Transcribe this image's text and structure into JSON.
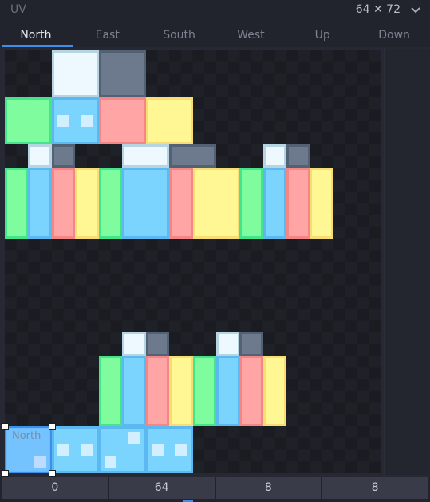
{
  "header": {
    "title": "UV",
    "texture_size": "64 ✕ 72",
    "dropdown_icon": "chevron-down-icon"
  },
  "tabs": [
    {
      "label": "North",
      "active": true
    },
    {
      "label": "East",
      "active": false
    },
    {
      "label": "South",
      "active": false
    },
    {
      "label": "West",
      "active": false
    },
    {
      "label": "Up",
      "active": false
    },
    {
      "label": "Down",
      "active": false
    }
  ],
  "texture": {
    "width_units": 64,
    "height_units": 72,
    "colors": {
      "top_border": "#b6d4e2",
      "top_fill": "#edf8ff",
      "bottom_border": "#526173",
      "bottom_fill": "#6d798c",
      "green_border": "#44e48a",
      "green_fill": "#7efc9e",
      "blue_border": "#5bb8f0",
      "blue_fill": "#7ad4fe",
      "red_border": "#f58686",
      "red_fill": "#ffa5a5",
      "yellow_border": "#f8dc74",
      "yellow_fill": "#fff793",
      "dot": "#d1efff"
    },
    "faces": [
      {
        "name": "head-up",
        "color": "top",
        "uv": [
          8,
          0,
          8,
          8
        ]
      },
      {
        "name": "head-down",
        "color": "bottom",
        "uv": [
          16,
          0,
          8,
          8
        ]
      },
      {
        "name": "head-east",
        "color": "green",
        "uv": [
          0,
          8,
          8,
          8
        ]
      },
      {
        "name": "head-north",
        "color": "blue",
        "uv": [
          8,
          8,
          8,
          8
        ],
        "dots": "eyes"
      },
      {
        "name": "head-west",
        "color": "red",
        "uv": [
          16,
          8,
          8,
          8
        ]
      },
      {
        "name": "head-south",
        "color": "yellow",
        "uv": [
          24,
          8,
          8,
          8
        ]
      },
      {
        "name": "leg-up",
        "color": "top",
        "uv": [
          4,
          16,
          4,
          4
        ]
      },
      {
        "name": "leg-down",
        "color": "bottom",
        "uv": [
          8,
          16,
          4,
          4
        ]
      },
      {
        "name": "leg-east",
        "color": "green",
        "uv": [
          0,
          20,
          4,
          12
        ]
      },
      {
        "name": "leg-north",
        "color": "blue",
        "uv": [
          4,
          20,
          4,
          12
        ]
      },
      {
        "name": "leg-west",
        "color": "red",
        "uv": [
          8,
          20,
          4,
          12
        ]
      },
      {
        "name": "leg-south",
        "color": "yellow",
        "uv": [
          12,
          20,
          4,
          12
        ]
      },
      {
        "name": "body-up",
        "color": "top",
        "uv": [
          20,
          16,
          8,
          4
        ]
      },
      {
        "name": "body-down",
        "color": "bottom",
        "uv": [
          28,
          16,
          8,
          4
        ]
      },
      {
        "name": "body-east",
        "color": "green",
        "uv": [
          16,
          20,
          4,
          12
        ]
      },
      {
        "name": "body-north",
        "color": "blue",
        "uv": [
          20,
          20,
          8,
          12
        ]
      },
      {
        "name": "body-west",
        "color": "red",
        "uv": [
          28,
          20,
          4,
          12
        ]
      },
      {
        "name": "body-south",
        "color": "yellow",
        "uv": [
          32,
          20,
          8,
          12
        ]
      },
      {
        "name": "arm-up",
        "color": "top",
        "uv": [
          44,
          16,
          4,
          4
        ]
      },
      {
        "name": "arm-down",
        "color": "bottom",
        "uv": [
          48,
          16,
          4,
          4
        ]
      },
      {
        "name": "arm-east",
        "color": "green",
        "uv": [
          40,
          20,
          4,
          12
        ]
      },
      {
        "name": "arm-north",
        "color": "blue",
        "uv": [
          44,
          20,
          4,
          12
        ]
      },
      {
        "name": "arm-west",
        "color": "red",
        "uv": [
          48,
          20,
          4,
          12
        ]
      },
      {
        "name": "arm-south",
        "color": "yellow",
        "uv": [
          52,
          20,
          4,
          12
        ]
      },
      {
        "name": "left-leg-up",
        "color": "top",
        "uv": [
          20,
          48,
          4,
          4
        ]
      },
      {
        "name": "left-leg-down",
        "color": "bottom",
        "uv": [
          24,
          48,
          4,
          4
        ]
      },
      {
        "name": "left-leg-east",
        "color": "green",
        "uv": [
          16,
          52,
          4,
          12
        ]
      },
      {
        "name": "left-leg-north",
        "color": "blue",
        "uv": [
          20,
          52,
          4,
          12
        ]
      },
      {
        "name": "left-leg-west",
        "color": "red",
        "uv": [
          24,
          52,
          4,
          12
        ]
      },
      {
        "name": "left-leg-south",
        "color": "yellow",
        "uv": [
          28,
          52,
          4,
          12
        ]
      },
      {
        "name": "left-arm-up",
        "color": "top",
        "uv": [
          36,
          48,
          4,
          4
        ]
      },
      {
        "name": "left-arm-down",
        "color": "bottom",
        "uv": [
          40,
          48,
          4,
          4
        ]
      },
      {
        "name": "left-arm-east",
        "color": "green",
        "uv": [
          32,
          52,
          4,
          12
        ]
      },
      {
        "name": "left-arm-north",
        "color": "blue",
        "uv": [
          36,
          52,
          4,
          12
        ]
      },
      {
        "name": "left-arm-west",
        "color": "red",
        "uv": [
          40,
          52,
          4,
          12
        ]
      },
      {
        "name": "left-arm-south",
        "color": "yellow",
        "uv": [
          44,
          52,
          4,
          12
        ]
      },
      {
        "name": "face-tile-1",
        "color": "blue",
        "uv": [
          8,
          64,
          8,
          8
        ],
        "dots": "eyes"
      },
      {
        "name": "face-tile-2",
        "color": "blue",
        "uv": [
          16,
          64,
          8,
          8
        ],
        "dots": "diagonal"
      },
      {
        "name": "face-tile-3",
        "color": "blue",
        "uv": [
          24,
          64,
          8,
          8
        ],
        "dots": "eyes"
      }
    ],
    "selected_face": {
      "label": "North",
      "uv": [
        0,
        64,
        8,
        8
      ],
      "fill": "#6bbcff",
      "inner": "#74c3ff",
      "border": "#3e8fe9"
    }
  },
  "footer": {
    "fields": [
      {
        "name": "uv-x-field",
        "value": "0"
      },
      {
        "name": "uv-y-field",
        "value": "64"
      },
      {
        "name": "uv-width-field",
        "value": "8"
      },
      {
        "name": "uv-height-field",
        "value": "8"
      }
    ]
  }
}
